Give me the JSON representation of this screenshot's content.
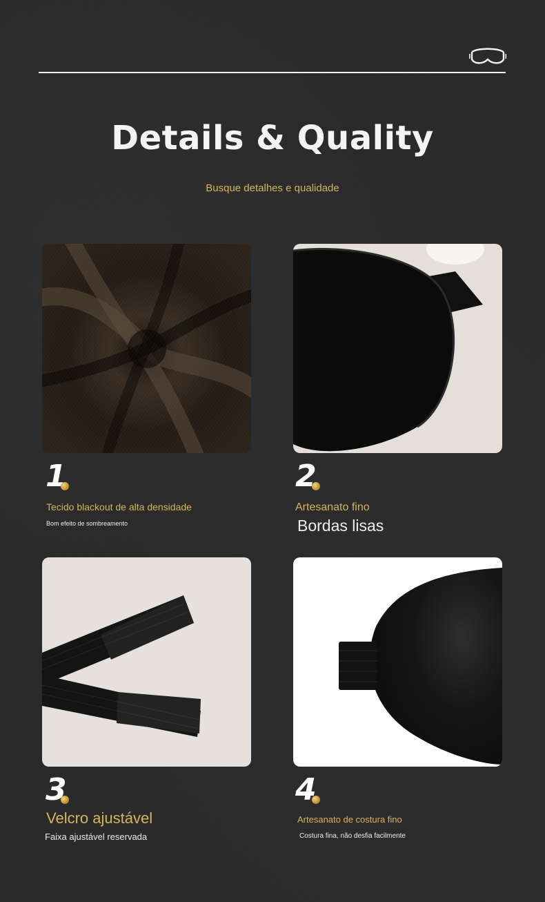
{
  "header": {
    "title": "Details & Quality",
    "subtitle": "Busque detalhes e qualidade",
    "icon": "sleep-mask-icon"
  },
  "items": [
    {
      "number": "1",
      "title": "Tecido blackout de alta densidade",
      "caption": "Bom efeito de sombreamento",
      "image": "dark fabric"
    },
    {
      "number": "2",
      "title": "Artesanato fino",
      "caption": "Bordas lisas",
      "image": "eye mask edge"
    },
    {
      "number": "3",
      "title": "Velcro ajustável",
      "caption": "Faixa ajustável reservada",
      "image": "elastic velcro strap"
    },
    {
      "number": "4",
      "title": "Artesanato de costura fino",
      "caption": "Costura fina, não desfia facilmente",
      "image": "mask side"
    }
  ],
  "colors": {
    "background": "#2a2a2a",
    "accent": "#d8b45c",
    "text": "#ededed"
  }
}
